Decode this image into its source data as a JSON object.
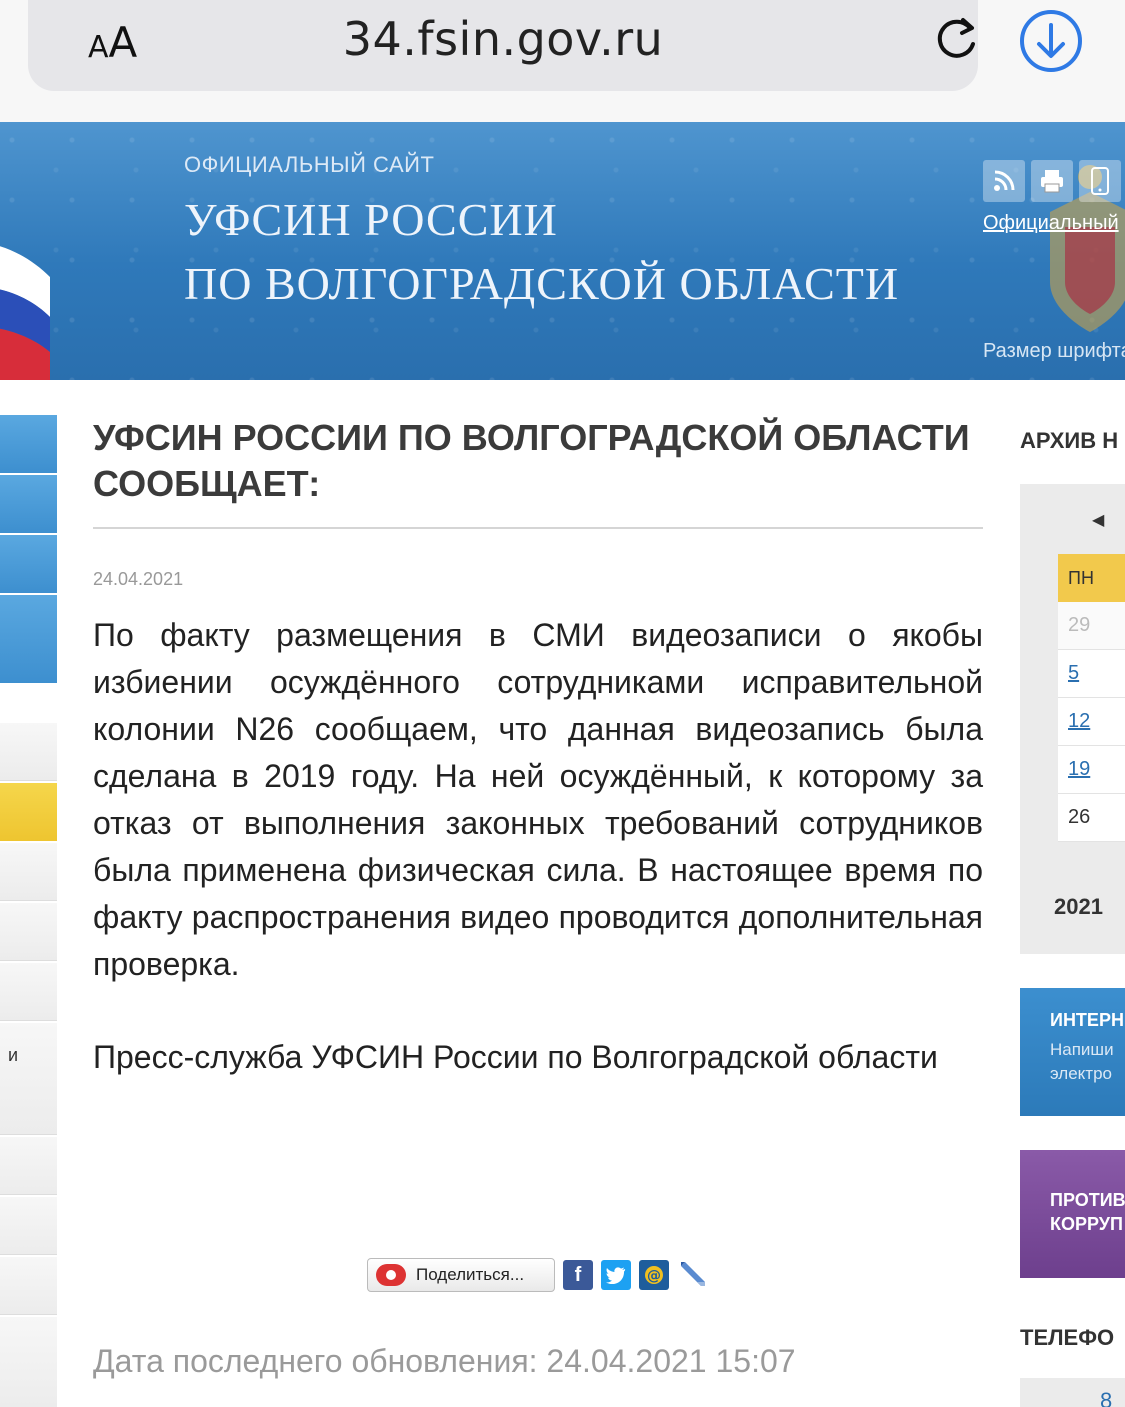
{
  "browser": {
    "aa_small": "A",
    "aa_large": "A",
    "url": "34.fsin.gov.ru"
  },
  "header": {
    "official_label": "ОФИЦИАЛЬНЫЙ САЙТ",
    "title_line1": "УФСИН РОССИИ",
    "title_line2": "ПО ВОЛГОГРАДСКОЙ ОБЛАСТИ",
    "official_link": "Официальный",
    "font_size_label": "Размер шрифта"
  },
  "left_sidebar": {
    "partial_text": "и"
  },
  "article": {
    "headline": "УФСИН РОССИИ ПО ВОЛГОГРАДСКОЙ ОБЛАСТИ СООБЩАЕТ:",
    "date": "24.04.2021",
    "body": "По факту размещения в СМИ видеозаписи о якобы избиении осуждённого сотрудниками исправительной колонии N26 сообщаем, что данная видеозапись была сделана в 2019 году. На ней осуждённый, к которому за отказ от выполнения законных требований сотрудников была применена физическая сила. В настоящее время по факту распространения видео проводится дополнительная проверка.",
    "signature": "Пресс-служба УФСИН России по Волгоградской области",
    "share_label": "Поделиться...",
    "last_updated": "Дата последнего обновления: 24.04.2021 15:07"
  },
  "right_column": {
    "archive_title": "АРХИВ Н",
    "calendar": {
      "weekday": "ПН",
      "days": [
        "29",
        "5",
        "12",
        "19",
        "26"
      ],
      "year": "2021"
    },
    "promo1": {
      "title": "ИНТЕРН",
      "sub1": "Напиши",
      "sub2": "электро"
    },
    "promo2": {
      "title1": "ПРОТИВ",
      "title2": "КОРРУП"
    },
    "phones_title": "ТЕЛЕФО",
    "phones_number": "8"
  },
  "colors": {
    "banner_blue": "#2f79ba",
    "calendar_header": "#f2c94c",
    "link_blue": "#2a6fb0",
    "promo_purple": "#7a4a9a"
  }
}
